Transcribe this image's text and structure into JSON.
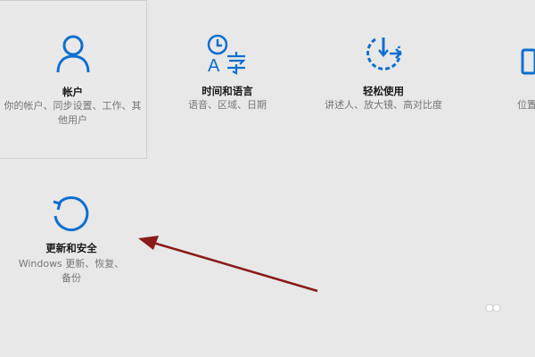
{
  "tiles": {
    "account": {
      "title": "帐户",
      "desc": "你的帐户、同步设置、工作、其他用户",
      "icon": "user-icon"
    },
    "time_language": {
      "title": "时间和语言",
      "desc": "语音、区域、日期",
      "icon": "time-language-icon"
    },
    "ease_of_access": {
      "title": "轻松使用",
      "desc": "讲述人、放大镜、高对比度",
      "icon": "ease-of-access-icon"
    },
    "privacy": {
      "desc": "位置",
      "icon": "privacy-icon"
    },
    "update_security": {
      "title": "更新和安全",
      "desc": "Windows 更新、恢复、备份",
      "icon": "refresh-icon"
    }
  },
  "colors": {
    "accent": "#0e6fd0",
    "arrow": "#8b1a1a",
    "background": "#e8e8e8"
  }
}
